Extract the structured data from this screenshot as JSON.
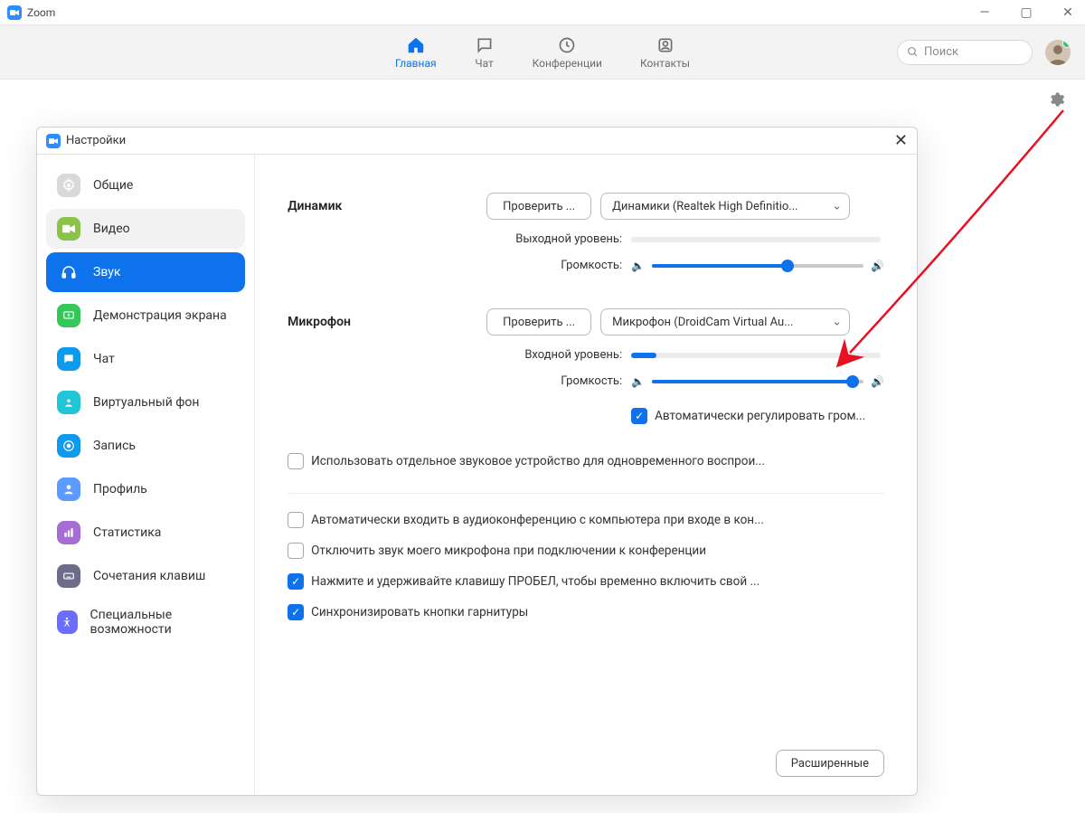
{
  "window": {
    "title": "Zoom"
  },
  "nav": {
    "items": [
      {
        "label": "Главная",
        "key": "home",
        "active": true
      },
      {
        "label": "Чат",
        "key": "chat"
      },
      {
        "label": "Конференции",
        "key": "meetings"
      },
      {
        "label": "Контакты",
        "key": "contacts"
      }
    ],
    "search_placeholder": "Поиск"
  },
  "settings": {
    "title": "Настройки",
    "sidebar": [
      {
        "label": "Общие",
        "icon": "gear",
        "color": "#c9c9c9",
        "key": "general"
      },
      {
        "label": "Видео",
        "icon": "video",
        "color": "#8bc34a",
        "key": "video",
        "hover": true
      },
      {
        "label": "Звук",
        "icon": "headphones",
        "color": "#0E72ED",
        "key": "audio",
        "active": true
      },
      {
        "label": "Демонстрация экрана",
        "icon": "share",
        "color": "#34c759",
        "key": "share"
      },
      {
        "label": "Чат",
        "icon": "chat",
        "color": "#0E9BED",
        "key": "chatset"
      },
      {
        "label": "Виртуальный фон",
        "icon": "vb",
        "color": "#20c5d6",
        "key": "vb"
      },
      {
        "label": "Запись",
        "icon": "record",
        "color": "#0E9BED",
        "key": "record"
      },
      {
        "label": "Профиль",
        "icon": "profile",
        "color": "#5b9bff",
        "key": "profile"
      },
      {
        "label": "Статистика",
        "icon": "stats",
        "color": "#a66dd4",
        "key": "stats"
      },
      {
        "label": "Сочетания клавиш",
        "icon": "keyboard",
        "color": "#6d6d8a",
        "key": "keys"
      },
      {
        "label": "Специальные возможности",
        "icon": "access",
        "color": "#6a6dff",
        "key": "access"
      }
    ],
    "speaker": {
      "label": "Динамик",
      "test_btn": "Проверить ...",
      "device": "Динамики (Realtek High Definitio...",
      "output_level_label": "Выходной уровень:",
      "output_level": 0,
      "volume_label": "Громкость:",
      "volume_percent": 64
    },
    "mic": {
      "label": "Микрофон",
      "test_btn": "Проверить ...",
      "device": "Микрофон (DroidCam Virtual Au...",
      "input_level_label": "Входной уровень:",
      "input_level": 10,
      "volume_label": "Громкость:",
      "volume_percent": 95,
      "auto_adjust_label": "Автоматически регулировать гром...",
      "auto_adjust_checked": true
    },
    "options": [
      {
        "label": "Использовать отдельное звуковое устройство для одновременного воспрои...",
        "checked": false
      },
      {
        "label": "Автоматически входить в аудиоконференцию с компьютера при входе в кон...",
        "checked": false
      },
      {
        "label": "Отключить звук моего микрофона при подключении к конференции",
        "checked": false
      },
      {
        "label": "Нажмите и удерживайте клавишу ПРОБЕЛ, чтобы временно включить свой ...",
        "checked": true
      },
      {
        "label": "Синхронизировать кнопки гарнитуры",
        "checked": true
      }
    ],
    "advanced_btn": "Расширенные"
  }
}
